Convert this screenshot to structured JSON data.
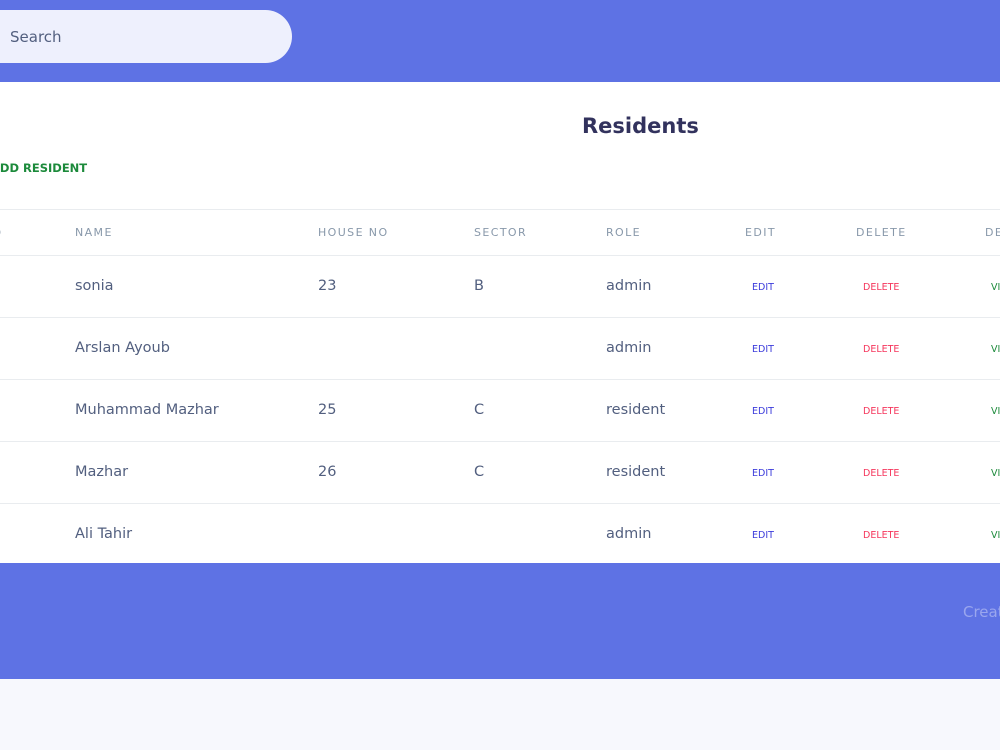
{
  "header": {
    "search_placeholder": "Search"
  },
  "page": {
    "title": "Residents",
    "add_button": "ADD RESIDENT"
  },
  "table": {
    "columns": {
      "id": "ID",
      "name": "NAME",
      "house_no": "HOUSE NO",
      "sector": "SECTOR",
      "role": "ROLE",
      "edit": "EDIT",
      "delete": "DELETE",
      "details": "DETAILS"
    },
    "rows": [
      {
        "name": "sonia",
        "house_no": "23",
        "sector": "B",
        "role": "admin",
        "edit": "EDIT",
        "delete": "DELETE",
        "details": "VIEW"
      },
      {
        "name": "Arslan Ayoub",
        "house_no": "",
        "sector": "",
        "role": "admin",
        "edit": "EDIT",
        "delete": "DELETE",
        "details": "VIEW"
      },
      {
        "name": "Muhammad Mazhar",
        "house_no": "25",
        "sector": "C",
        "role": "resident",
        "edit": "EDIT",
        "delete": "DELETE",
        "details": "VIEW"
      },
      {
        "name": "Mazhar",
        "house_no": "26",
        "sector": "C",
        "role": "resident",
        "edit": "EDIT",
        "delete": "DELETE",
        "details": "VIEW"
      },
      {
        "name": "Ali Tahir",
        "house_no": "",
        "sector": "",
        "role": "admin",
        "edit": "EDIT",
        "delete": "DELETE",
        "details": "VIEW"
      }
    ]
  },
  "footer": {
    "text": "Created"
  },
  "colors": {
    "primary": "#5e72e4",
    "edit": "#3b3bdb",
    "delete": "#f5365c",
    "success": "#1c8a3b"
  }
}
